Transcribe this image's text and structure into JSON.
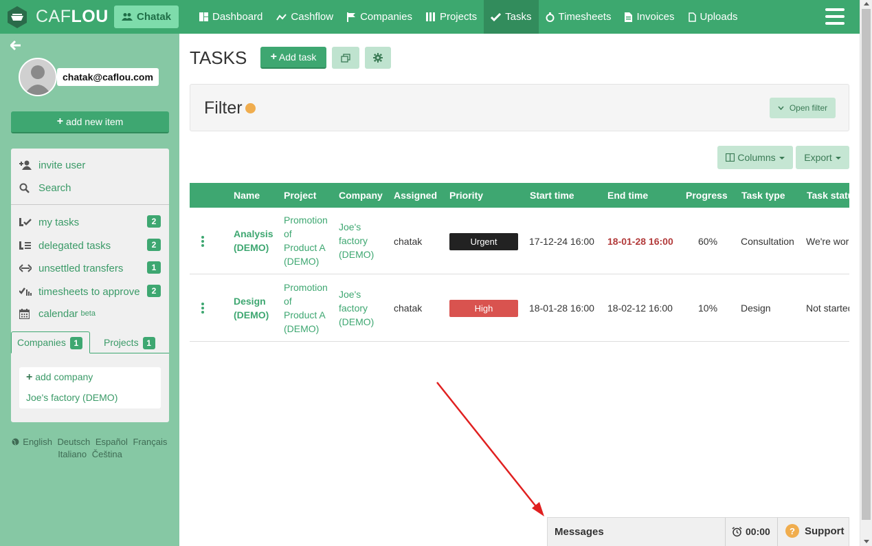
{
  "brand": {
    "logo_light": "CAF",
    "logo_bold": "LOU"
  },
  "user_button": {
    "label": "Chatak"
  },
  "nav": {
    "items": [
      {
        "label": "Dashboard",
        "icon": "dashboard-icon"
      },
      {
        "label": "Cashflow",
        "icon": "trend-icon"
      },
      {
        "label": "Companies",
        "icon": "flag-icon"
      },
      {
        "label": "Projects",
        "icon": "columns-icon"
      },
      {
        "label": "Tasks",
        "icon": "check-icon",
        "active": true
      },
      {
        "label": "Timesheets",
        "icon": "stopwatch-icon"
      },
      {
        "label": "Invoices",
        "icon": "invoice-icon"
      },
      {
        "label": "Uploads",
        "icon": "file-icon"
      }
    ]
  },
  "sidebar": {
    "email": "chatak@caflou.com",
    "add_new_item": "add new item",
    "items": [
      {
        "label": "invite user",
        "icon": "add-user-icon"
      },
      {
        "label": "Search",
        "icon": "search-icon"
      },
      {
        "label": "my tasks",
        "icon": "my-tasks-icon",
        "badge": "2"
      },
      {
        "label": "delegated tasks",
        "icon": "delegated-tasks-icon",
        "badge": "2"
      },
      {
        "label": "unsettled transfers",
        "icon": "transfer-icon",
        "badge": "1"
      },
      {
        "label": "timesheets to approve",
        "icon": "approve-icon",
        "badge": "2"
      },
      {
        "label": "calendar",
        "icon": "calendar-icon",
        "suffix": "beta"
      }
    ],
    "tabs": [
      {
        "label": "Companies",
        "badge": "1",
        "active": true
      },
      {
        "label": "Projects",
        "badge": "1"
      }
    ],
    "add_company": "add company",
    "companies": [
      "Joe's factory (DEMO)"
    ],
    "languages_row1": [
      "English",
      "Deutsch",
      "Español",
      "Français"
    ],
    "languages_row2": [
      "Italiano",
      "Čeština"
    ]
  },
  "page": {
    "title": "TASKS",
    "add_task": "Add task",
    "filter_title": "Filter",
    "open_filter": "Open filter",
    "columns_btn": "Columns",
    "export_btn": "Export"
  },
  "table": {
    "headers": [
      "Name",
      "Project",
      "Company",
      "Assigned",
      "Priority",
      "Start time",
      "End time",
      "Progress",
      "Task type",
      "Task status"
    ],
    "rows": [
      {
        "name": [
          "Analysis",
          "(DEMO)"
        ],
        "project": [
          "Promotion",
          "of",
          "Product A",
          "(DEMO)"
        ],
        "company": [
          "Joe's",
          "factory",
          "(DEMO)"
        ],
        "assigned": "chatak",
        "priority": "Urgent",
        "priority_color": "#222222",
        "start": "17-12-24 16:00",
        "end": "18-01-28 16:00",
        "end_overdue": true,
        "progress": "60%",
        "type": "Consultation",
        "status": "We're working on it"
      },
      {
        "name": [
          "Design",
          "(DEMO)"
        ],
        "project": [
          "Promotion",
          "of",
          "Product A",
          "(DEMO)"
        ],
        "company": [
          "Joe's",
          "factory",
          "(DEMO)"
        ],
        "assigned": "chatak",
        "priority": "High",
        "priority_color": "#d9534f",
        "start": "18-01-28 16:00",
        "end": "18-02-12 16:00",
        "end_overdue": false,
        "progress": "10%",
        "type": "Design",
        "status": "Not started"
      }
    ]
  },
  "messages_bar": {
    "label": "Messages",
    "timer": "00:00",
    "support": "Support"
  },
  "colors": {
    "primary": "#3da86f",
    "sidebar": "#86c8a4",
    "accent_orange": "#f0ad4e",
    "annotation_arrow": "#e02020"
  }
}
